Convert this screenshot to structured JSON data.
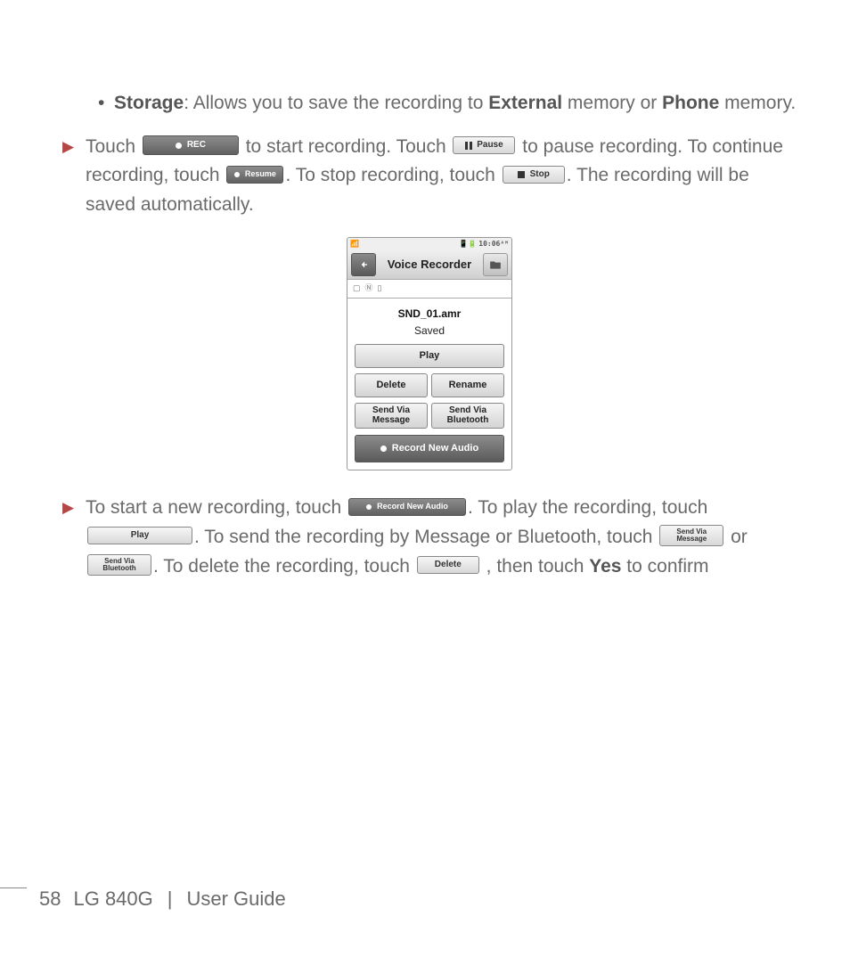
{
  "text": {
    "storage_bold": "Storage",
    "storage_desc": ": Allows you to save the recording to ",
    "external_bold": "External",
    "storage_desc2": " memory or ",
    "phone_bold": "Phone",
    "storage_desc3": " memory.",
    "p1_a": "Touch ",
    "p1_b": " to start recording. Touch ",
    "p1_c": " to pause recording. To continue recording, touch ",
    "p1_d": ". To stop recording, touch ",
    "p1_e": ". The recording will be saved automatically.",
    "p2_a": "To start a new recording, touch ",
    "p2_b": ". To play the recording, touch ",
    "p2_c": ". To send the recording by Message or Bluetooth, touch ",
    "p2_or": " or ",
    "p2_d": ". To delete the recording, touch ",
    "p2_e": " , then touch ",
    "yes_bold": "Yes",
    "p2_f": " to confirm"
  },
  "buttons": {
    "rec": "REC",
    "pause": "Pause",
    "resume": "Resume",
    "stop": "Stop",
    "record_new_audio": "Record New Audio",
    "play": "Play",
    "send_via_message_l1": "Send Via",
    "send_via_message_l2": "Message",
    "send_via_bluetooth_l1": "Send Via",
    "send_via_bluetooth_l2": "Bluetooth",
    "delete": "Delete"
  },
  "phone": {
    "status_time": "10:06ᴬᴹ",
    "title": "Voice Recorder",
    "filename": "SND_01.amr",
    "saved": "Saved",
    "play": "Play",
    "delete": "Delete",
    "rename": "Rename",
    "svm_l1": "Send Via",
    "svm_l2": "Message",
    "svb_l1": "Send Via",
    "svb_l2": "Bluetooth",
    "record_new": "Record New Audio"
  },
  "footer": {
    "page": "58",
    "title": "LG 840G",
    "sep": "|",
    "label": "User Guide"
  }
}
